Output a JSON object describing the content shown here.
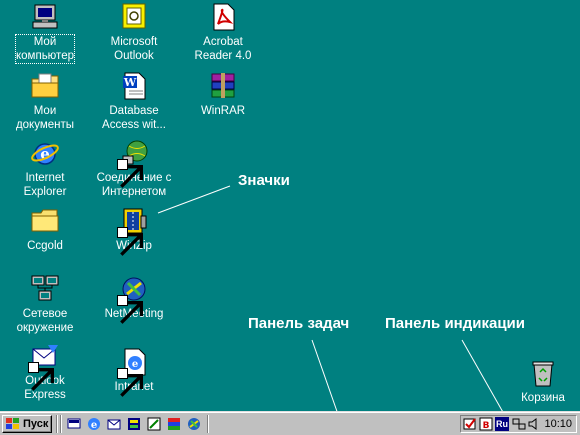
{
  "desktop": {
    "icons": [
      {
        "label_1": "Мой",
        "label_2": "компьютер",
        "icon": "my-computer-icon"
      },
      {
        "label_1": "Мои",
        "label_2": "документы",
        "icon": "my-documents-icon"
      },
      {
        "label_1": "Internet",
        "label_2": "Explorer",
        "icon": "internet-explorer-icon"
      },
      {
        "label_1": "Ccgold",
        "label_2": "",
        "icon": "folder-icon"
      },
      {
        "label_1": "Сетевое",
        "label_2": "окружение",
        "icon": "network-neighborhood-icon"
      },
      {
        "label_1": "Outlook",
        "label_2": "Express",
        "icon": "outlook-express-icon"
      },
      {
        "label_1": "Microsoft",
        "label_2": "Outlook",
        "icon": "microsoft-outlook-icon"
      },
      {
        "label_1": "Database",
        "label_2": "Access wit...",
        "icon": "word-document-icon"
      },
      {
        "label_1": "Соединение с",
        "label_2": "Интернетом",
        "icon": "internet-connection-icon"
      },
      {
        "label_1": "WinZip",
        "label_2": "",
        "icon": "winzip-icon"
      },
      {
        "label_1": "NetMeeting",
        "label_2": "",
        "icon": "netmeeting-icon"
      },
      {
        "label_1": "Intranet",
        "label_2": "",
        "icon": "intranet-icon"
      },
      {
        "label_1": "Acrobat",
        "label_2": "Reader 4.0",
        "icon": "acrobat-reader-icon"
      },
      {
        "label_1": "WinRAR",
        "label_2": "",
        "icon": "winrar-icon"
      },
      {
        "label_1": "Корзина",
        "label_2": "",
        "icon": "recycle-bin-icon"
      }
    ]
  },
  "annotations": {
    "icons": "Значки",
    "taskbar": "Панель задач",
    "tray": "Панель индикации"
  },
  "taskbar": {
    "start_label": "Пуск",
    "quick_launch": [
      "show-desktop-icon",
      "internet-explorer-icon",
      "outlook-express-icon",
      "channels-icon",
      "edit-icon",
      "media-icon",
      "connect-icon"
    ],
    "tray": {
      "language": "Ru",
      "clock": "10:10",
      "icons": [
        "task-scheduler-icon",
        "antivirus-icon",
        "network-icon",
        "speaker-icon"
      ]
    }
  },
  "colors": {
    "desktop": "#008080",
    "taskbar": "#c0c0c0",
    "label_text": "#ffffff"
  }
}
